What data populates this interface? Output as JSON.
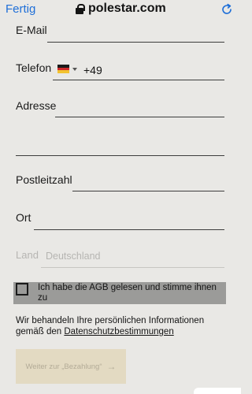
{
  "browser": {
    "done_label": "Fertig",
    "host": "polestar.com"
  },
  "form": {
    "email_label": "E-Mail",
    "phone_label": "Telefon",
    "phone_prefix": "+49",
    "address_label": "Adresse",
    "postcode_label": "Postleitzahl",
    "city_label": "Ort",
    "country_label": "Land",
    "country_value": "Deutschland",
    "consent_text": "Ich habe die AGB gelesen und stimme ihnen zu",
    "consent_checked": false,
    "privacy_text": "Wir behandeln Ihre persönlichen Informationen gemäß den ",
    "privacy_link": "Datenschutzbestimmungen",
    "submit_label": "Weiter zur „Bezahlung“"
  },
  "icons": {
    "lock": "lock-icon",
    "reload": "reload-icon",
    "flag": "germany-flag-icon",
    "arrow": "arrow-right-icon"
  },
  "colors": {
    "background": "#e9e8e5",
    "link_blue": "#1f6fd8",
    "consent_bg": "#9b9b99",
    "submit_bg": "#e3dac2",
    "submit_text": "#b3ab97"
  }
}
